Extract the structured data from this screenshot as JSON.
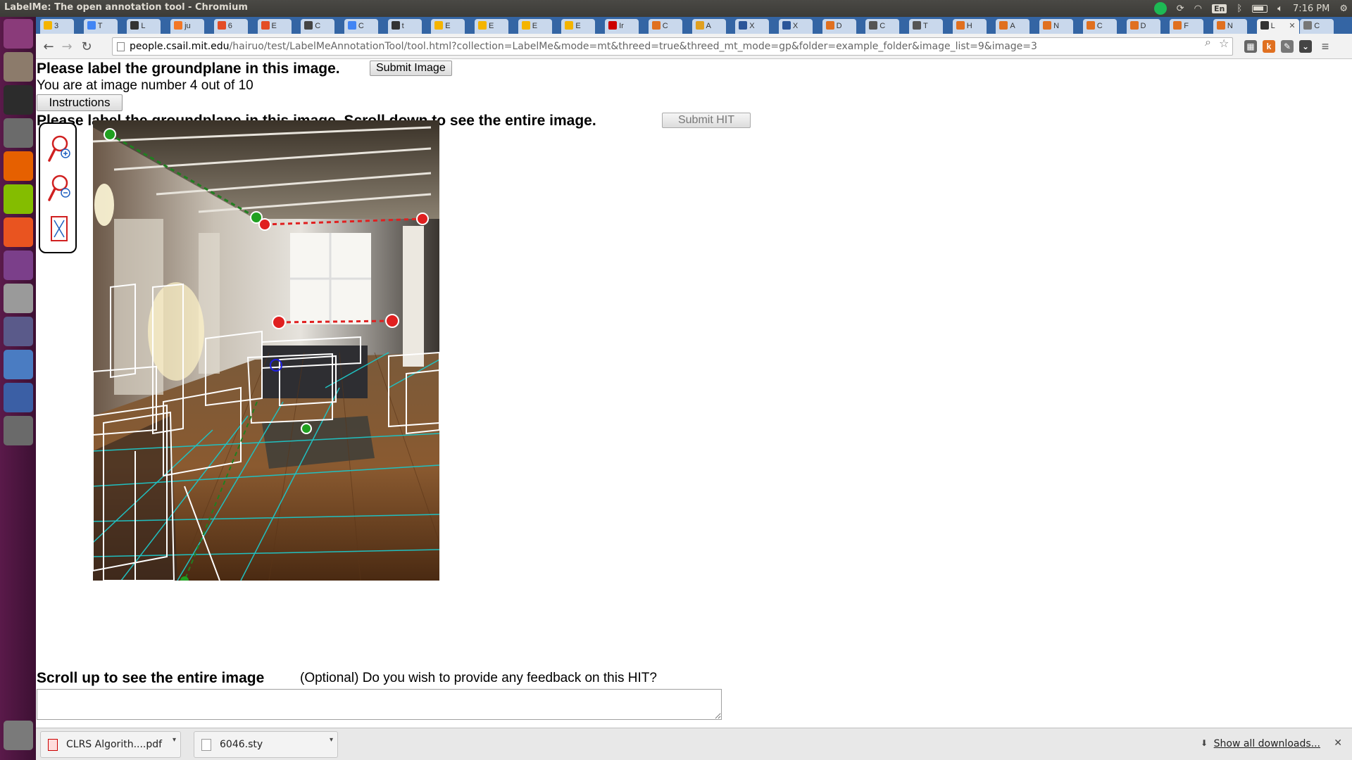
{
  "window": {
    "title": "LabelMe: The open annotation tool - Chromium"
  },
  "system_tray": {
    "lang": "En",
    "time": "7:16 PM"
  },
  "tabs": [
    {
      "label": "3",
      "fav": "#f4b400"
    },
    {
      "label": "T",
      "fav": "#4285f4"
    },
    {
      "label": "L",
      "fav": "#333333"
    },
    {
      "label": "ju",
      "fav": "#f37726"
    },
    {
      "label": "6",
      "fav": "#e44d26"
    },
    {
      "label": "E",
      "fav": "#e44d26"
    },
    {
      "label": "C",
      "fav": "#444444"
    },
    {
      "label": "C",
      "fav": "#4285f4"
    },
    {
      "label": "t",
      "fav": "#333333"
    },
    {
      "label": "E",
      "fav": "#f4b400"
    },
    {
      "label": "E",
      "fav": "#f4b400"
    },
    {
      "label": "E",
      "fav": "#f4b400"
    },
    {
      "label": "E",
      "fav": "#f4b400"
    },
    {
      "label": "Ir",
      "fav": "#cc0000"
    },
    {
      "label": "C",
      "fav": "#e07020"
    },
    {
      "label": "A",
      "fav": "#e0a020"
    },
    {
      "label": "X",
      "fav": "#2a5599"
    },
    {
      "label": "X",
      "fav": "#2a5599"
    },
    {
      "label": "D",
      "fav": "#e07020"
    },
    {
      "label": "C",
      "fav": "#555555"
    },
    {
      "label": "T",
      "fav": "#555555"
    },
    {
      "label": "H",
      "fav": "#e07020"
    },
    {
      "label": "A",
      "fav": "#e07020"
    },
    {
      "label": "N",
      "fav": "#e07020"
    },
    {
      "label": "C",
      "fav": "#e07020"
    },
    {
      "label": "D",
      "fav": "#e07020"
    },
    {
      "label": "F",
      "fav": "#e07020"
    },
    {
      "label": "N",
      "fav": "#e07020"
    },
    {
      "label": "L",
      "fav": "#333333",
      "active": true
    },
    {
      "label": "C",
      "fav": "#777777"
    }
  ],
  "toolbar": {
    "url_host": "people.csail.mit.edu",
    "url_path": "/hairuo/test/LabelMeAnnotationTool/tool.html?collection=LabelMe&mode=mt&threed=true&threed_mt_mode=gp&folder=example_folder&image_list=9&image=3"
  },
  "page": {
    "heading": "Please label the groundplane in this image.",
    "submit_image": "Submit Image",
    "counter": "You are at image number 4 out of 10",
    "instructions": "Instructions",
    "heading2": "Please label the groundplane in this image. Scroll down to see the entire image.",
    "submit_hit": "Submit HIT",
    "scroll_up": "Scroll up to see the entire image",
    "feedback_label": "(Optional) Do you wish to provide any feedback on this HIT?",
    "feedback_value": ""
  },
  "downloads": {
    "items": [
      "CLRS Algorith....pdf",
      "6046.sty"
    ],
    "show_all": "Show all downloads..."
  },
  "launcher": [
    {
      "name": "ubuntu-dash-icon",
      "color": "#8a3b7a"
    },
    {
      "name": "files-icon",
      "color": "#8c7b6b"
    },
    {
      "name": "terminal-icon",
      "color": "#2c2c2c"
    },
    {
      "name": "system-settings-icon",
      "color": "#6b6b6b"
    },
    {
      "name": "firefox-icon",
      "color": "#e66000"
    },
    {
      "name": "spotify-icon",
      "color": "#84bd00"
    },
    {
      "name": "software-center-icon",
      "color": "#e95420"
    },
    {
      "name": "unity-tweak-icon",
      "color": "#7b3f8a"
    },
    {
      "name": "disks-icon",
      "color": "#9a9a9a"
    },
    {
      "name": "text-editor-icon",
      "color": "#5a5a8a"
    },
    {
      "name": "chromium-icon",
      "color": "#4a7cc2"
    },
    {
      "name": "shotwell-icon",
      "color": "#3b5fa5"
    },
    {
      "name": "software-updater-icon",
      "color": "#6a6a6a"
    },
    {
      "name": "trash-icon",
      "color": "#7a7a7a"
    }
  ]
}
